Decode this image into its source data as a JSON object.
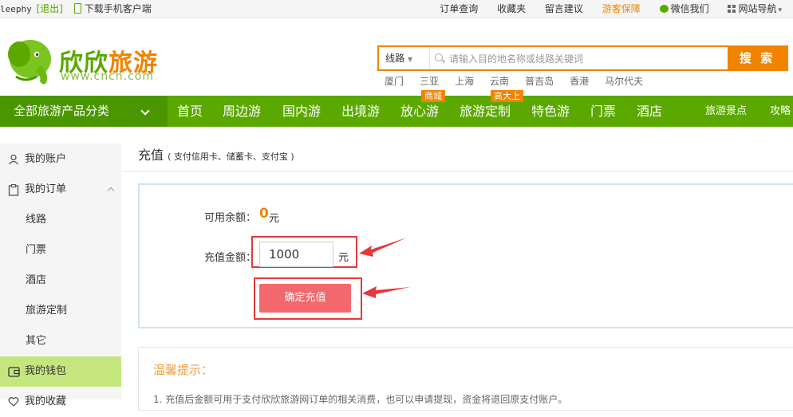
{
  "topbar": {
    "username": "leephy",
    "logout": "[退出]",
    "mobile_client": "下载手机客户端",
    "links": {
      "orders": "订单查询",
      "favorites": "收藏夹",
      "feedback": "留言建议",
      "guarantee": "游客保障",
      "wechat": "微信我们",
      "sitemap": "网站导航"
    }
  },
  "logo": {
    "name_green": "欣欣",
    "name_orange": "旅游",
    "url": "www.cncn.com"
  },
  "search": {
    "category": "线路",
    "placeholder": "请输入目的地名称或线路关键词",
    "button": "搜 索",
    "hot_keywords": [
      "厦门",
      "三亚",
      "上海",
      "云南",
      "普吉岛",
      "香港",
      "马尔代夫"
    ]
  },
  "nav": {
    "all_categories": "全部旅游产品分类",
    "items": [
      "首页",
      "周边游",
      "国内游",
      "出境游",
      "放心游",
      "旅游定制",
      "特色游",
      "门票",
      "酒店"
    ],
    "badges": {
      "mall": "商城",
      "premium": "高大上"
    },
    "right_items": [
      "旅游景点",
      "攻略"
    ]
  },
  "sidebar": {
    "account": "我的账户",
    "orders": "我的订单",
    "order_subitems": [
      "线路",
      "门票",
      "酒店",
      "旅游定制",
      "其它"
    ],
    "wallet": "我的钱包",
    "favorites": "我的收藏"
  },
  "main": {
    "title": "充值",
    "title_note": "( 支付信用卡、储蓄卡、支付宝 )",
    "balance_label": "可用余额：",
    "balance_value": "0",
    "balance_unit": "元",
    "amount_label": "充值金额：",
    "amount_value": "1000",
    "amount_unit": "元",
    "confirm_button": "确定充值",
    "tips_title": "温馨提示：",
    "tips_text": "1. 充值后金额可用于支付欣欣旅游网订单的相关消费，也可以申请提现，资金将退回原支付账户。"
  },
  "colors": {
    "brand_green": "#5aa800",
    "brand_orange": "#f08300",
    "highlight_red": "#e5383b",
    "button_red": "#f2686c",
    "wallet_active": "#c5e67f"
  }
}
